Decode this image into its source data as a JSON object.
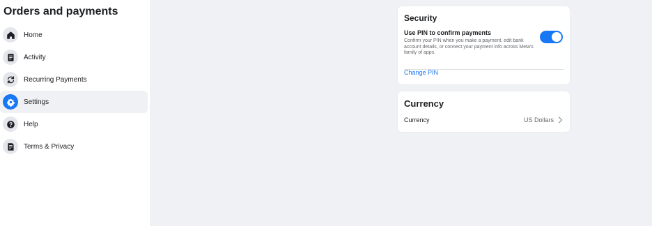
{
  "sidebar": {
    "title": "Orders and payments",
    "items": [
      {
        "label": "Home",
        "icon": "home-icon"
      },
      {
        "label": "Activity",
        "icon": "receipt-icon"
      },
      {
        "label": "Recurring Payments",
        "icon": "refresh-icon"
      },
      {
        "label": "Settings",
        "icon": "gear-icon",
        "active": true
      },
      {
        "label": "Help",
        "icon": "help-icon"
      },
      {
        "label": "Terms & Privacy",
        "icon": "document-icon"
      }
    ]
  },
  "security": {
    "heading": "Security",
    "pin_title": "Use PIN to confirm payments",
    "pin_description": "Confirm your PIN when you make a payment, edit bank account details, or connect your payment info across Meta's family of apps.",
    "pin_enabled": true,
    "change_pin_label": "Change PIN"
  },
  "currency": {
    "heading": "Currency",
    "label": "Currency",
    "value": "US Dollars"
  },
  "colors": {
    "accent": "#1877f2",
    "background": "#f0f1f4",
    "card": "#ffffff"
  }
}
